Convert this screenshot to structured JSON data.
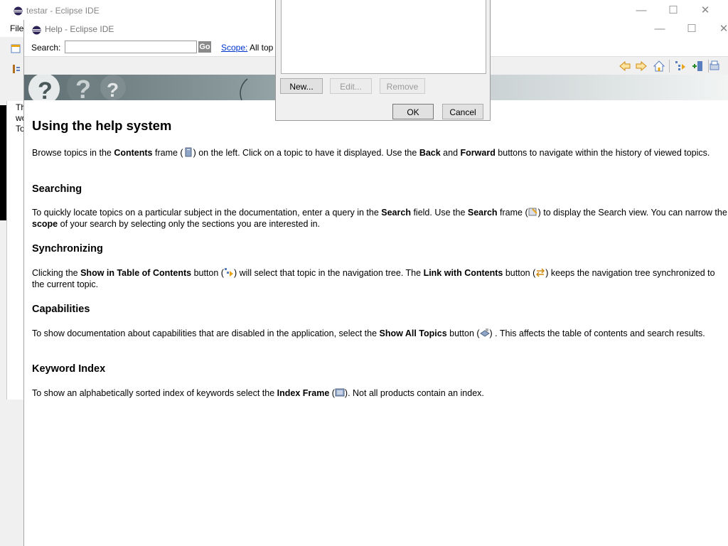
{
  "ide": {
    "title": "testar - Eclipse IDE",
    "menu_file": "File",
    "snippets": [
      "Th",
      "wo",
      "To"
    ]
  },
  "help": {
    "title": "Help - Eclipse IDE",
    "search_label": "Search:",
    "search_value": "",
    "go_label": "Go",
    "scope_label": "Scope:",
    "scope_value": "All top",
    "toolbar_icons": [
      "back-icon",
      "forward-icon",
      "home-icon",
      "show-in-toc-icon",
      "bookmark-icon",
      "print-icon"
    ]
  },
  "content": {
    "title": "Using the help system",
    "p1_a": "Browse topics in the ",
    "p1_b": "Contents",
    "p1_c": " frame (",
    "p1_d": ") on the left. Click on a topic to have it displayed. Use the ",
    "p1_e": "Back",
    "p1_f": " and ",
    "p1_g": "Forward",
    "p1_h": " buttons to navigate within the history of viewed topics.",
    "h_search": "Searching",
    "p2_a": "To quickly locate topics on a particular subject in the documentation, enter a query in the ",
    "p2_b": "Search",
    "p2_c": " field. Use the ",
    "p2_d": "Search",
    "p2_e": " frame (",
    "p2_f": ") to display the Search view. You can narrow the ",
    "p2_g": "scope",
    "p2_h": " of your search by selecting only the sections you are interested in.",
    "h_sync": "Synchronizing",
    "p3_a": "Clicking the ",
    "p3_b": "Show in Table of Contents",
    "p3_c": " button (",
    "p3_d": ") will select that topic in the navigation tree. The ",
    "p3_e": "Link with Contents",
    "p3_f": " button (",
    "p3_g": ") keeps the navigation tree synchronized to the current topic.",
    "h_cap": "Capabilities",
    "p4_a": "To show documentation about capabilities that are disabled in the application, select the ",
    "p4_b": "Show All Topics",
    "p4_c": " button (",
    "p4_d": ") . This affects the table of contents and search results.",
    "h_index": "Keyword Index",
    "p5_a": "To show an alphabetically sorted index of keywords select the ",
    "p5_b": "Index Frame",
    "p5_c": " (",
    "p5_d": "). Not all products contain an index."
  },
  "dialog": {
    "new_label": "New...",
    "edit_label": "Edit...",
    "remove_label": "Remove",
    "ok_label": "OK",
    "cancel_label": "Cancel"
  },
  "colors": {
    "link": "#0033cc",
    "banner_dark": "#5f6e72",
    "icon_accent": "#e8a317"
  }
}
